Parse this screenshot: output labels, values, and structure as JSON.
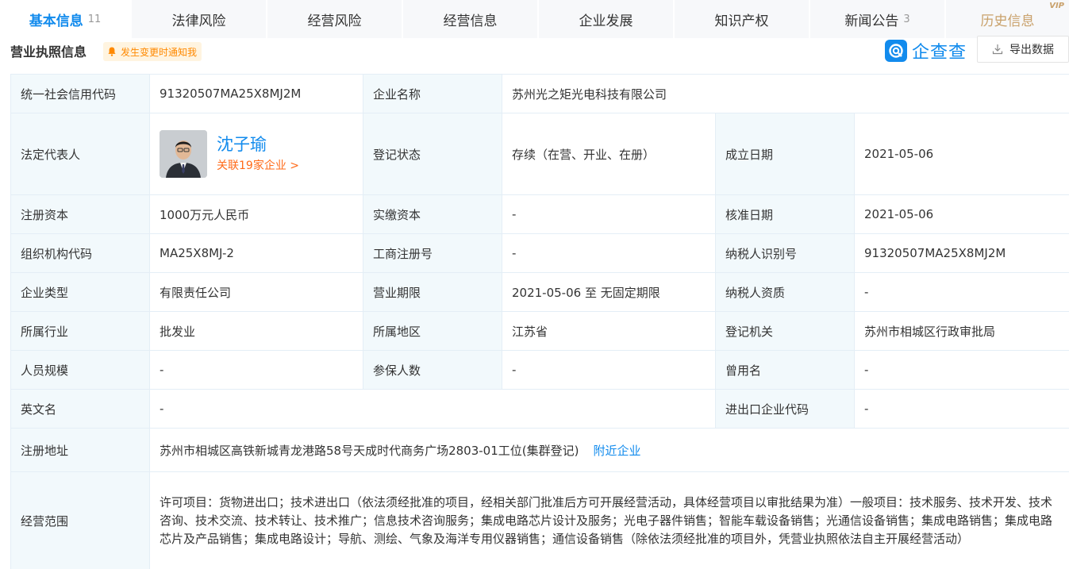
{
  "tabs": [
    {
      "label": "基本信息",
      "count": "11"
    },
    {
      "label": "法律风险",
      "count": ""
    },
    {
      "label": "经营风险",
      "count": ""
    },
    {
      "label": "经营信息",
      "count": ""
    },
    {
      "label": "企业发展",
      "count": ""
    },
    {
      "label": "知识产权",
      "count": ""
    },
    {
      "label": "新闻公告",
      "count": "3"
    },
    {
      "label": "历史信息",
      "count": "",
      "badge": "VIP"
    }
  ],
  "section": {
    "title": "营业执照信息",
    "notify_label": "发生变更时通知我",
    "brand_name": "企查查",
    "export_label": "导出数据"
  },
  "rows": {
    "credit_code_label": "统一社会信用代码",
    "credit_code": "91320507MA25X8MJ2M",
    "company_name_label": "企业名称",
    "company_name": "苏州光之矩光电科技有限公司",
    "legal_rep_label": "法定代表人",
    "legal_rep_name": "沈子瑜",
    "legal_rep_link": "关联19家企业 >",
    "reg_status_label": "登记状态",
    "reg_status": "存续（在营、开业、在册）",
    "found_date_label": "成立日期",
    "found_date": "2021-05-06",
    "reg_capital_label": "注册资本",
    "reg_capital": "1000万元人民币",
    "paid_capital_label": "实缴资本",
    "paid_capital": "-",
    "approve_date_label": "核准日期",
    "approve_date": "2021-05-06",
    "org_code_label": "组织机构代码",
    "org_code": "MA25X8MJ-2",
    "biz_reg_no_label": "工商注册号",
    "biz_reg_no": "-",
    "taxpayer_id_label": "纳税人识别号",
    "taxpayer_id": "91320507MA25X8MJ2M",
    "company_type_label": "企业类型",
    "company_type": "有限责任公司",
    "biz_term_label": "营业期限",
    "biz_term": "2021-05-06 至 无固定期限",
    "taxpayer_qual_label": "纳税人资质",
    "taxpayer_qual": "-",
    "industry_label": "所属行业",
    "industry": "批发业",
    "region_label": "所属地区",
    "region": "江苏省",
    "reg_authority_label": "登记机关",
    "reg_authority": "苏州市相城区行政审批局",
    "staff_size_label": "人员规模",
    "staff_size": "-",
    "insured_label": "参保人数",
    "insured": "-",
    "former_name_label": "曾用名",
    "former_name": "-",
    "english_name_label": "英文名",
    "english_name": "-",
    "import_export_label": "进出口企业代码",
    "import_export": "-",
    "address_label": "注册地址",
    "address": "苏州市相城区高铁新城青龙港路58号天成时代商务广场2803-01工位(集群登记)",
    "nearby_label": "附近企业",
    "scope_label": "经营范围",
    "scope": "许可项目：货物进出口；技术进出口（依法须经批准的项目，经相关部门批准后方可开展经营活动，具体经营项目以审批结果为准）一般项目：技术服务、技术开发、技术咨询、技术交流、技术转让、技术推广；信息技术咨询服务；集成电路芯片设计及服务；光电子器件销售；智能车载设备销售；光通信设备销售；集成电路销售；集成电路芯片及产品销售；集成电路设计；导航、测绘、气象及海洋专用仪器销售；通信设备销售（除依法须经批准的项目外，凭营业执照依法自主开展经营活动）"
  },
  "colors": {
    "accent": "#128bed",
    "label_bg": "#f2f9fc",
    "link_orange": "#ff6b1a",
    "vip_gold": "#c9a16b"
  }
}
